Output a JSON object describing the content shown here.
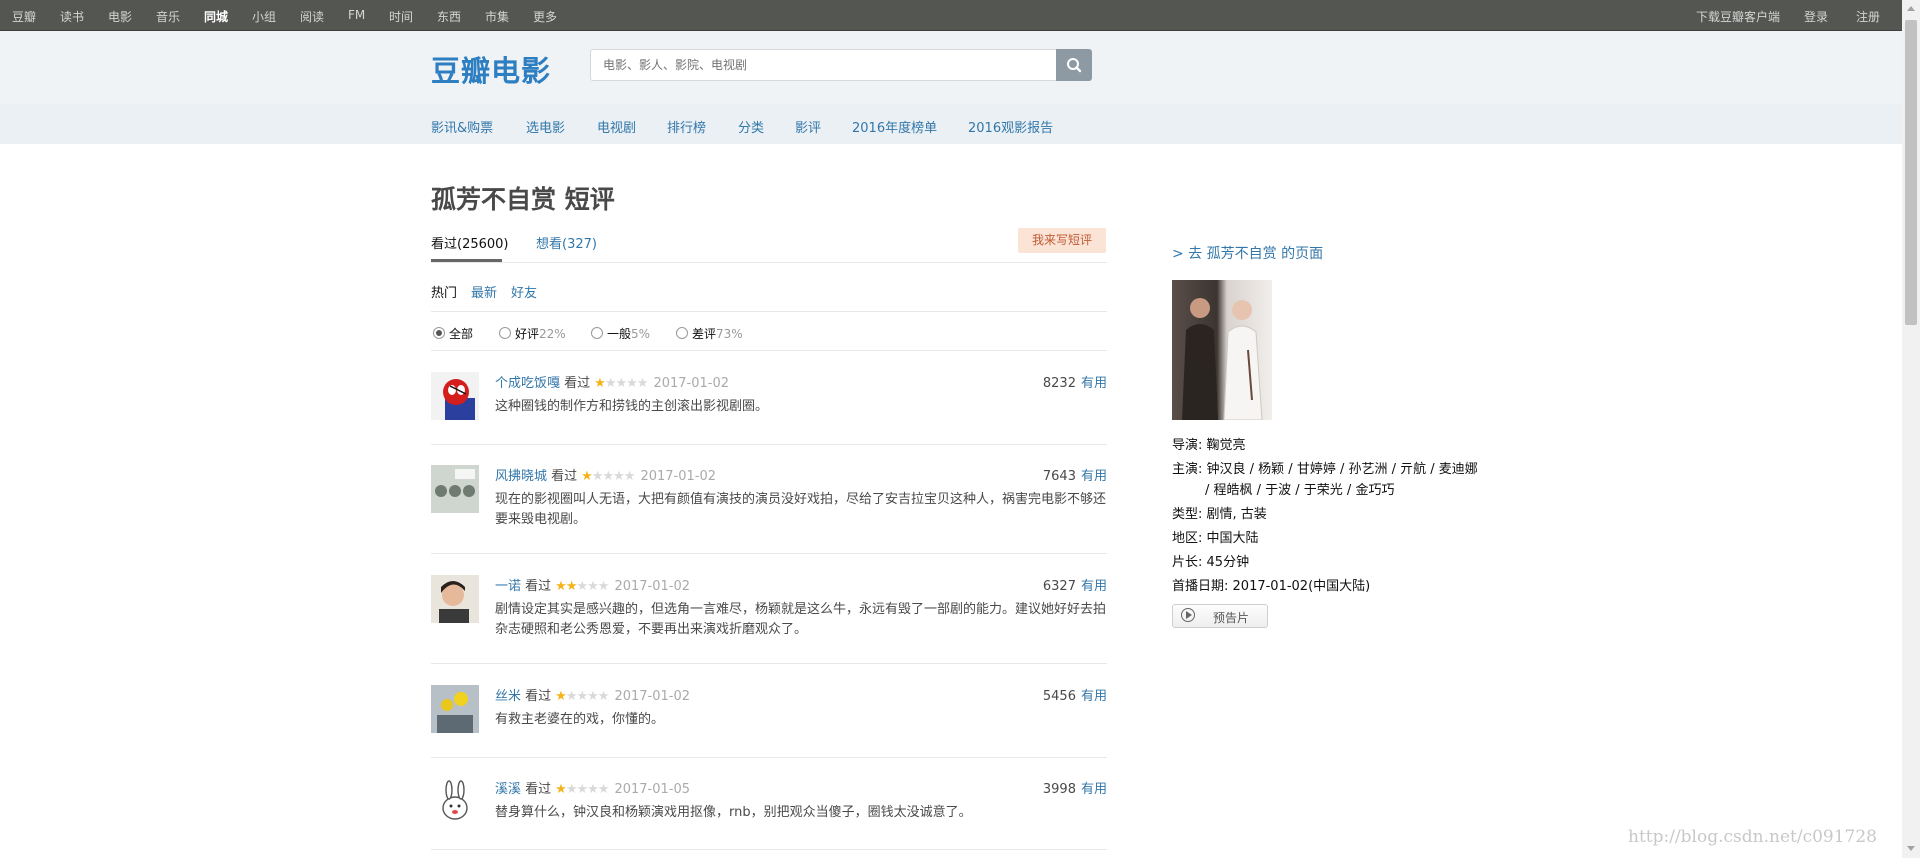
{
  "global_nav": {
    "left": [
      "豆瓣",
      "读书",
      "电影",
      "音乐",
      "同城",
      "小组",
      "阅读",
      "FM",
      "时间",
      "东西",
      "市集",
      "更多"
    ],
    "right": [
      "下载豆瓣客户端",
      "登录",
      "注册"
    ]
  },
  "header": {
    "logo": "豆瓣电影",
    "search_placeholder": "电影、影人、影院、电视剧"
  },
  "sub_nav": [
    "影讯&购票",
    "选电影",
    "电视剧",
    "排行榜",
    "分类",
    "影评",
    "2016年度榜单",
    "2016观影报告"
  ],
  "page": {
    "title": "孤芳不自赏 短评",
    "tabs": [
      "看过(25600)",
      "想看(327)"
    ],
    "write_button": "我来写短评",
    "sort": [
      "热门",
      "最新",
      "好友"
    ],
    "filters": [
      {
        "label": "全部",
        "pct": ""
      },
      {
        "label": "好评",
        "pct": "22%"
      },
      {
        "label": "一般",
        "pct": "5%"
      },
      {
        "label": "差评",
        "pct": "73%"
      }
    ]
  },
  "comments": [
    {
      "user": "个成吃饭嘎",
      "status": "看过",
      "rating": 1,
      "date": "2017-01-02",
      "votes": "8232",
      "useful": "有用",
      "text": "这种圈钱的制作方和捞钱的主创滚出影视剧圈。"
    },
    {
      "user": "风拂晓城",
      "status": "看过",
      "rating": 1,
      "date": "2017-01-02",
      "votes": "7643",
      "useful": "有用",
      "text": "现在的影视圈叫人无语，大把有颜值有演技的演员没好戏拍，尽给了安吉拉宝贝这种人，祸害完电影不够还要来毁电视剧。"
    },
    {
      "user": "一诺",
      "status": "看过",
      "rating": 2,
      "date": "2017-01-02",
      "votes": "6327",
      "useful": "有用",
      "text": "剧情设定其实是感兴趣的，但选角一言难尽，杨颖就是这么牛，永远有毁了一部剧的能力。建议她好好去拍杂志硬照和老公秀恩爱，不要再出来演戏折磨观众了。"
    },
    {
      "user": "丝米",
      "status": "看过",
      "rating": 1,
      "date": "2017-01-02",
      "votes": "5456",
      "useful": "有用",
      "text": "有救主老婆在的戏，你懂的。"
    },
    {
      "user": "溪溪",
      "status": "看过",
      "rating": 1,
      "date": "2017-01-05",
      "votes": "3998",
      "useful": "有用",
      "text": "替身算什么，钟汉良和杨颖演戏用抠像，rnb，别把观众当傻子，圈钱太没诚意了。"
    }
  ],
  "aside": {
    "link": "> 去 孤芳不自赏 的页面",
    "director_label": "导演:",
    "director": "鞠觉亮",
    "cast_label": "主演:",
    "cast_line1": "钟汉良 / 杨颖 / 甘婷婷 / 孙艺洲 / 亓航 / 麦迪娜",
    "cast_line2": "/ 程皓枫 / 于波 / 于荣光 / 金巧巧",
    "genre_label": "类型:",
    "genre": "剧情, 古装",
    "region_label": "地区:",
    "region": "中国大陆",
    "length_label": "片长:",
    "length": "45分钟",
    "premiere_label": "首播日期:",
    "premiere": "2017-01-02(中国大陆)",
    "trailer": "预告片"
  },
  "watermark": "http://blog.csdn.net/c091728"
}
